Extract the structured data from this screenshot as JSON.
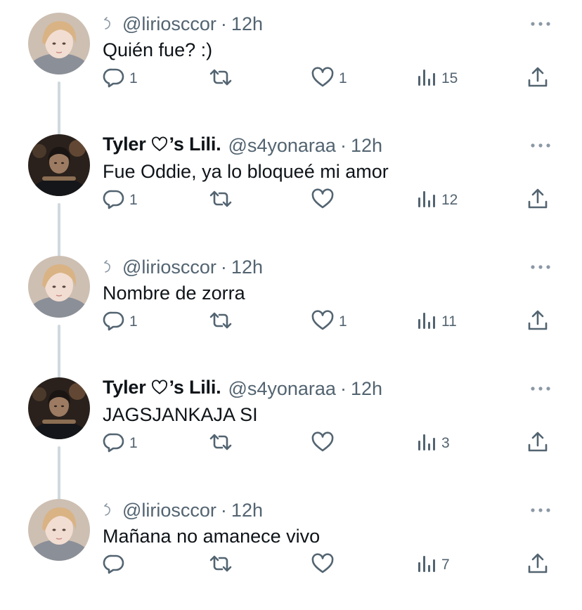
{
  "tweets": [
    {
      "author": "liriosccor",
      "display_name": "",
      "handle": "@liriosccor",
      "time": "12h",
      "text": "Quién fue? :)",
      "replies": "1",
      "retweets": "",
      "likes": "1",
      "views": "15",
      "has_reply_mark": true
    },
    {
      "author": "s4yonaraa",
      "display_name_prefix": "Tyler",
      "display_name_suffix": "’s Lili.",
      "handle": "@s4yonaraa",
      "time": "12h",
      "text": "Fue Oddie, ya lo bloqueé mi amor",
      "replies": "1",
      "retweets": "",
      "likes": "",
      "views": "12",
      "has_reply_mark": false
    },
    {
      "author": "liriosccor",
      "display_name": "",
      "handle": "@liriosccor",
      "time": "12h",
      "text": "Nombre de zorra",
      "replies": "1",
      "retweets": "",
      "likes": "1",
      "views": "11",
      "has_reply_mark": true
    },
    {
      "author": "s4yonaraa",
      "display_name_prefix": "Tyler",
      "display_name_suffix": "’s Lili.",
      "handle": "@s4yonaraa",
      "time": "12h",
      "text": "JAGSJANKAJA SI",
      "replies": "1",
      "retweets": "",
      "likes": "",
      "views": "3",
      "has_reply_mark": false
    },
    {
      "author": "liriosccor",
      "display_name": "",
      "handle": "@liriosccor",
      "time": "12h",
      "text": "Mañana no amanece vivo",
      "replies": "",
      "retweets": "",
      "likes": "",
      "views": "7",
      "has_reply_mark": true
    }
  ],
  "separator": "·",
  "icons": {
    "reply": "reply-icon",
    "retweet": "retweet-icon",
    "like": "heart-icon",
    "views": "views-icon",
    "share": "share-icon",
    "more": "more-icon",
    "reply_mark": "reply-mark-icon",
    "name_heart": "heart-outline-icon"
  },
  "colors": {
    "text": "#0f1419",
    "secondary": "#536471",
    "thread_line": "#cfd9de",
    "background": "#ffffff"
  }
}
